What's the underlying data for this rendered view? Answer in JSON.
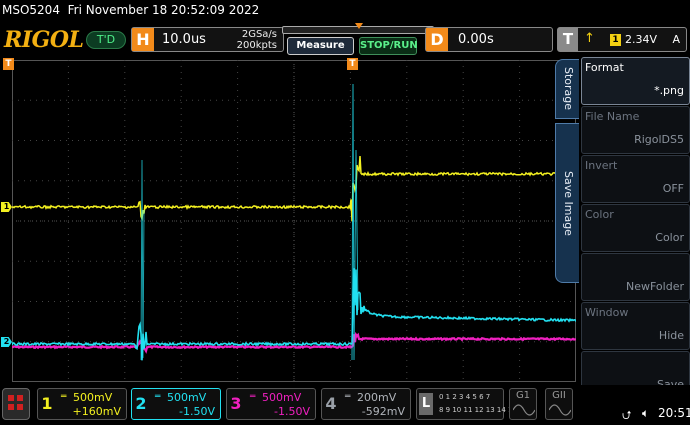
{
  "header": {
    "model": "MSO5204",
    "date": "Fri November 18 20:52:09 2022",
    "brand": "RIGOL",
    "trigger_status": "T'D"
  },
  "horizontal": {
    "label": "H",
    "timebase": "10.0us",
    "sample_rate": "2GSa/s",
    "memory_depth": "200kpts"
  },
  "buttons": {
    "measure": "Measure",
    "stop_run": "STOP/RUN"
  },
  "delay": {
    "label": "D",
    "value": "0.00s"
  },
  "trigger": {
    "label": "T",
    "source": "1",
    "level": "2.34V",
    "mode": "A",
    "position_marker": "T",
    "delay_marker": "T"
  },
  "channel_markers": {
    "ch1": "1",
    "ch2": "2"
  },
  "side_menu": {
    "tab_storage": "Storage",
    "tab_save_image": "Save Image",
    "items": [
      {
        "label": "Format",
        "value": "*.png",
        "active": true
      },
      {
        "label": "File Name",
        "value": "RigolDS5",
        "active": false
      },
      {
        "label": "Invert",
        "value": "OFF",
        "active": false
      },
      {
        "label": "Color",
        "value": "Color",
        "active": false
      },
      {
        "label": "",
        "value": "NewFolder",
        "active": false
      },
      {
        "label": "Window",
        "value": "Hide",
        "active": false
      },
      {
        "label": "",
        "value": "Save",
        "active": false
      }
    ]
  },
  "channels": [
    {
      "num": "1",
      "scale": "500mV",
      "offset": "+160mV",
      "color": "#f3f020"
    },
    {
      "num": "2",
      "scale": "500mV",
      "offset": "-1.50V",
      "color": "#22e0f0"
    },
    {
      "num": "3",
      "scale": "500mV",
      "offset": "-1.50V",
      "color": "#f020c0"
    },
    {
      "num": "4",
      "scale": "200mV",
      "offset": "-592mV",
      "color": "#9aa0a8"
    }
  ],
  "logic_analyzer": {
    "label": "L",
    "row1": "0 1 2 3  4 5 6 7",
    "row2": "8 9 10 11 12 13 14 15"
  },
  "generators": {
    "g1": "G1",
    "g2": "GII"
  },
  "status": {
    "time": "20:51"
  },
  "colors": {
    "accent_orange": "#f28a1a",
    "ch1_yellow": "#f3f020",
    "ch2_cyan": "#22e0f0",
    "ch3_magenta": "#f020c0",
    "brand_gold": "#f3b012"
  }
}
